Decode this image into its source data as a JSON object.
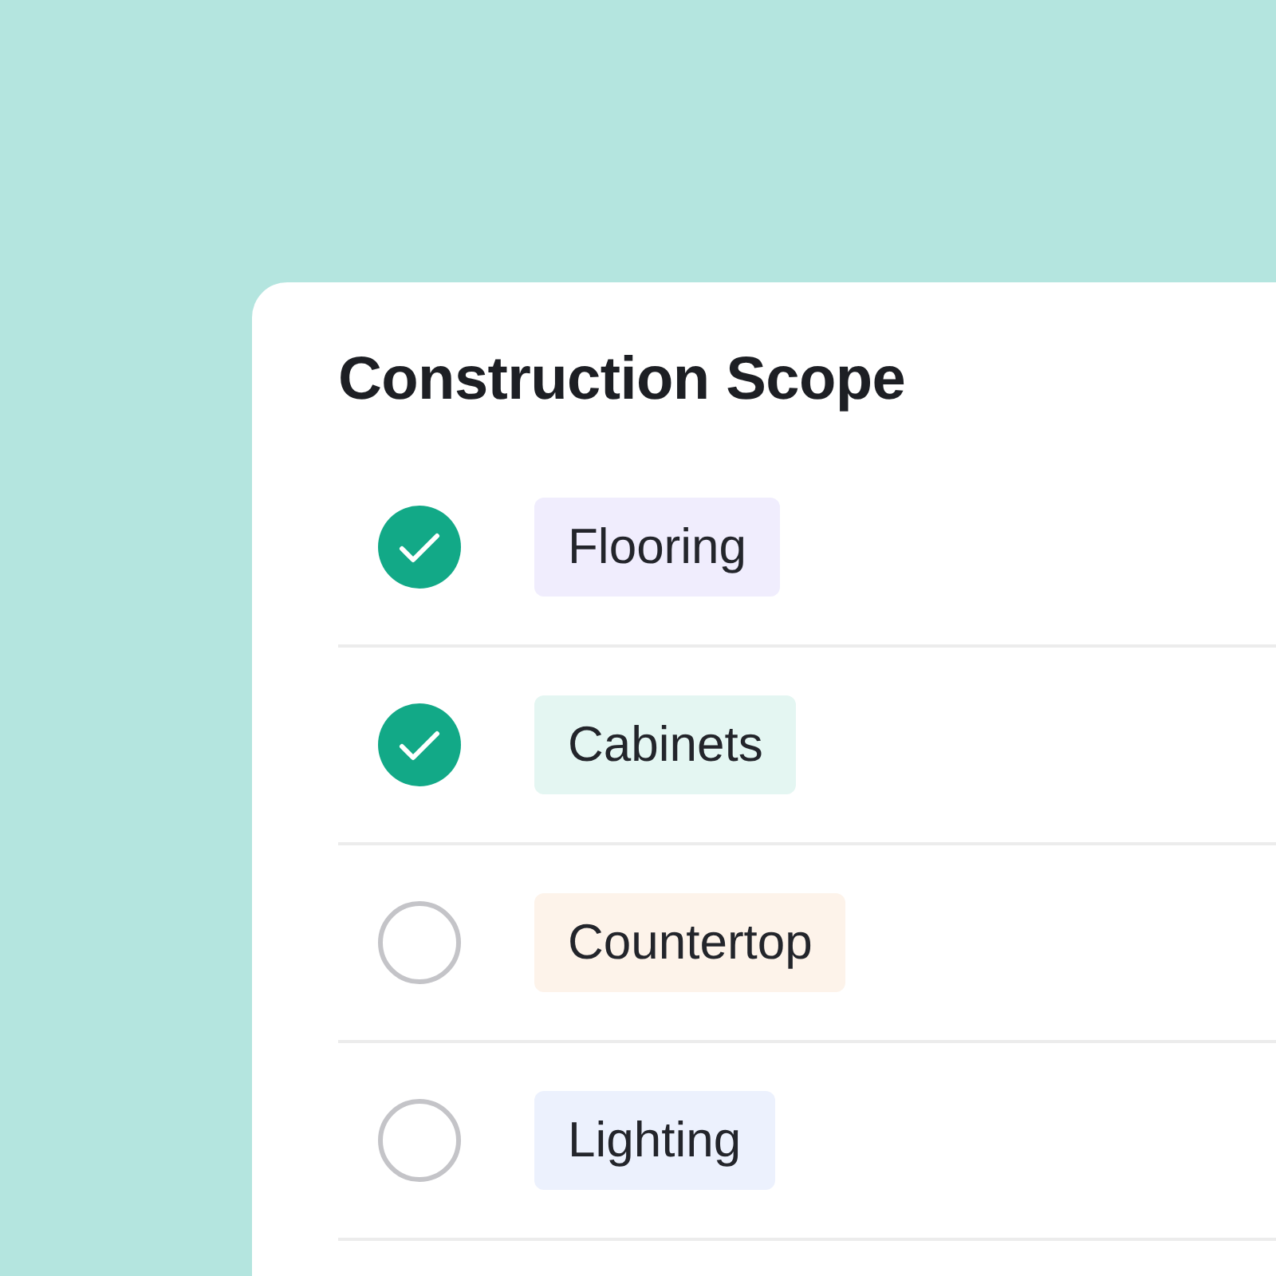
{
  "card": {
    "title": "Construction Scope"
  },
  "items": [
    {
      "label": "Flooring",
      "checked": true,
      "color": "#f0edfd"
    },
    {
      "label": "Cabinets",
      "checked": true,
      "color": "#e4f6f2"
    },
    {
      "label": "Countertop",
      "checked": false,
      "color": "#fdf3ea"
    },
    {
      "label": "Lighting",
      "checked": false,
      "color": "#ecf1fd"
    }
  ]
}
